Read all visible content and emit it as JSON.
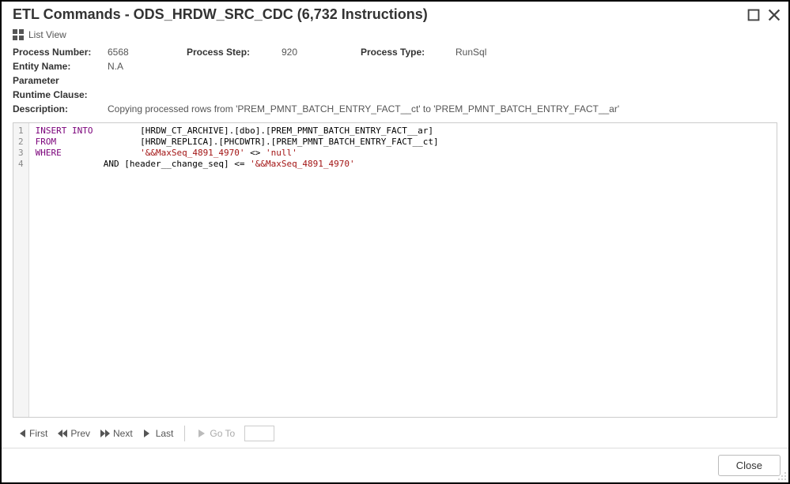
{
  "title": "ETL Commands - ODS_HRDW_SRC_CDC (6,732 Instructions)",
  "toolbar": {
    "list_view": "List View"
  },
  "meta": {
    "process_number_label": "Process Number:",
    "process_number": "6568",
    "process_step_label": "Process Step:",
    "process_step": "920",
    "process_type_label": "Process Type:",
    "process_type": "RunSql",
    "entity_name_label": "Entity Name:",
    "entity_name": "N.A",
    "parameter_label": "Parameter",
    "runtime_clause_label": "Runtime Clause:",
    "description_label": "Description:",
    "description": "Copying processed rows from 'PREM_PMNT_BATCH_ENTRY_FACT__ct' to 'PREM_PMNT_BATCH_ENTRY_FACT__ar'"
  },
  "code": {
    "lines": [
      {
        "n": "1",
        "kw": "INSERT INTO",
        "rest": "         [HRDW_CT_ARCHIVE].[dbo].[PREM_PMNT_BATCH_ENTRY_FACT__ar]"
      },
      {
        "n": "2",
        "kw": "FROM",
        "rest": "                [HRDW_REPLICA].[PHCDWTR].[PREM_PMNT_BATCH_ENTRY_FACT__ct]"
      },
      {
        "n": "3",
        "kw": "WHERE",
        "rest_pre": "               ",
        "str1": "'&&MaxSeq_4891_4970'",
        "mid": " <> ",
        "str2": "'null'"
      },
      {
        "n": "4",
        "kw": "",
        "rest_pre": "             AND [header__change_seq] <= ",
        "str1": "'&&MaxSeq_4891_4970'"
      }
    ]
  },
  "pager": {
    "first": "First",
    "prev": "Prev",
    "next": "Next",
    "last": "Last",
    "goto": "Go To"
  },
  "footer": {
    "close": "Close"
  }
}
